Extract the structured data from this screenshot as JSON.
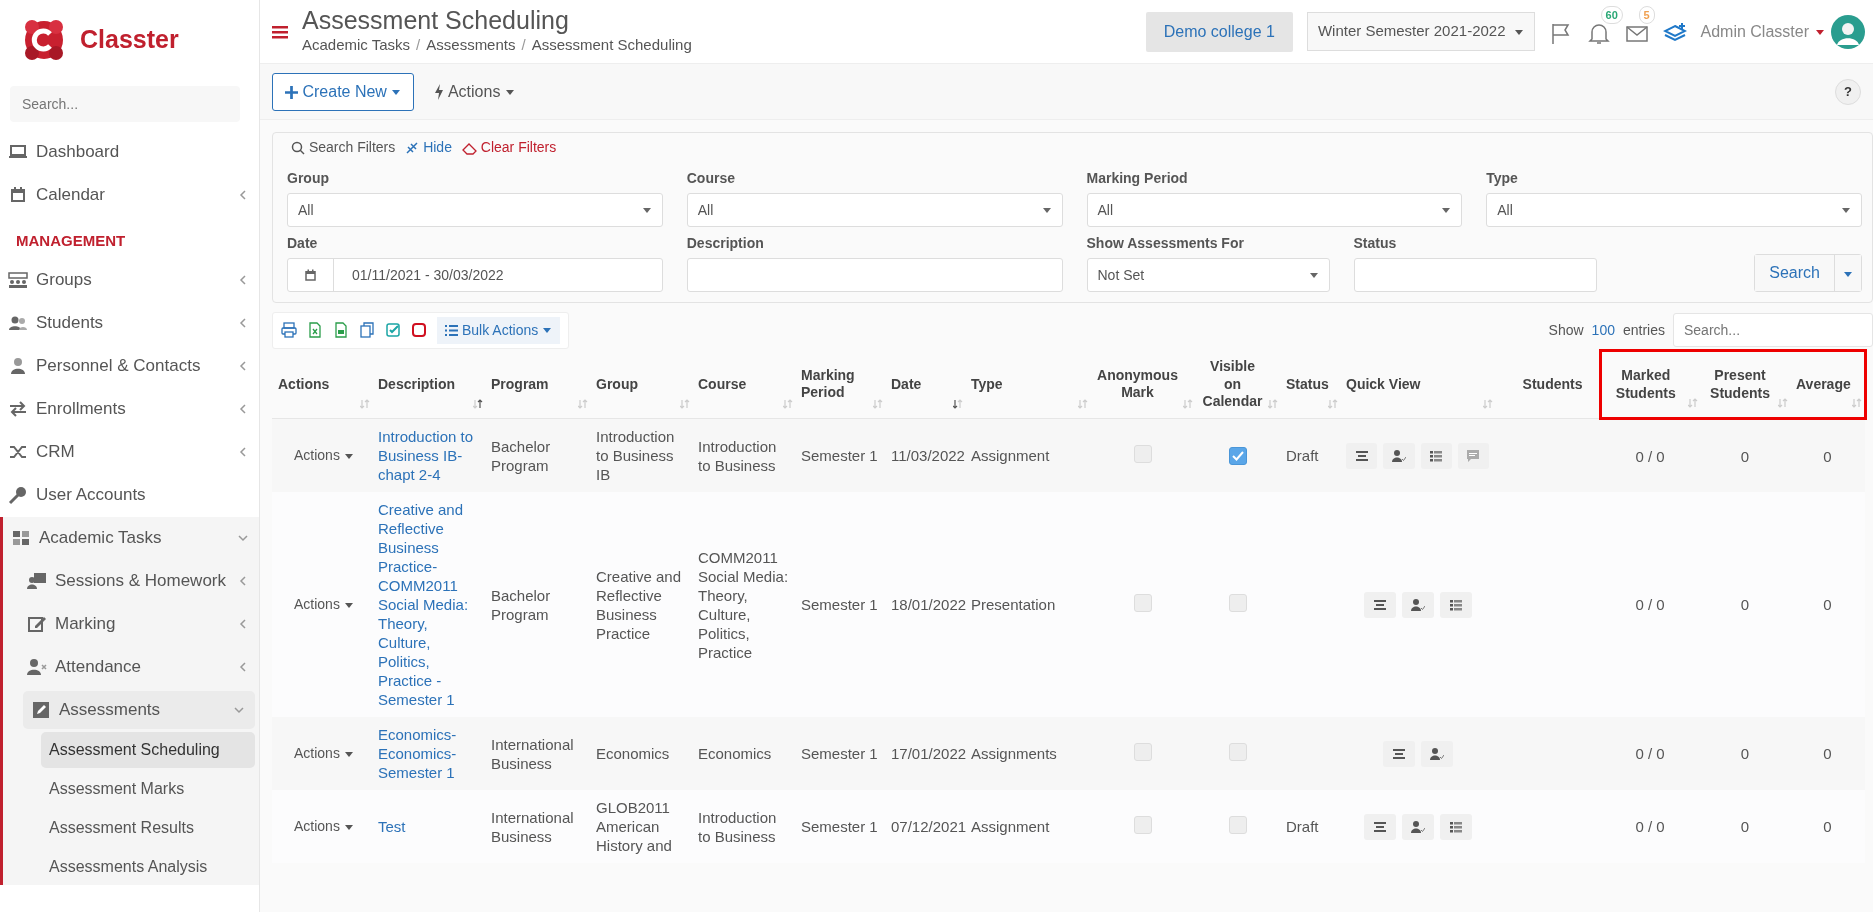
{
  "sidebar": {
    "brand": "Classter",
    "search_placeholder": "Search...",
    "items": [
      {
        "kind": "link",
        "label": "Dashboard"
      },
      {
        "kind": "link",
        "label": "Calendar",
        "expanded": false
      },
      {
        "kind": "section",
        "label": "MANAGEMENT"
      },
      {
        "kind": "link",
        "label": "Groups",
        "expanded": false
      },
      {
        "kind": "link",
        "label": "Students",
        "expanded": false
      },
      {
        "kind": "link",
        "label": "Personnel & Contacts",
        "expanded": false
      },
      {
        "kind": "link",
        "label": "Enrollments",
        "expanded": false
      },
      {
        "kind": "link",
        "label": "CRM",
        "expanded": false
      },
      {
        "kind": "link",
        "label": "User Accounts"
      },
      {
        "kind": "link",
        "label": "Academic Tasks",
        "expanded": true,
        "children": [
          {
            "label": "Sessions & Homework",
            "expanded": false
          },
          {
            "label": "Marking",
            "expanded": false
          },
          {
            "label": "Attendance",
            "expanded": false
          },
          {
            "label": "Assessments",
            "expanded": true,
            "children": [
              {
                "label": "Assessment Scheduling",
                "selected": true
              },
              {
                "label": "Assessment Marks",
                "selected": false
              },
              {
                "label": "Assessment Results",
                "selected": false
              },
              {
                "label": "Assessments Analysis",
                "selected": false
              }
            ]
          }
        ]
      }
    ]
  },
  "header": {
    "title": "Assessment Scheduling",
    "breadcrumb": [
      {
        "label": "Academic Tasks",
        "separator": "/"
      },
      {
        "label": "Assessments",
        "separator": "/"
      },
      {
        "label": "Assessment Scheduling"
      }
    ],
    "institution": "Demo college 1",
    "period": "Winter Semester 2021-2022",
    "indicators": [
      {
        "kind": "flag"
      },
      {
        "kind": "bell",
        "count": "60",
        "color": "#2aa876"
      },
      {
        "kind": "mail",
        "count": "5",
        "color": "#f0a050"
      },
      {
        "kind": "layers"
      }
    ],
    "user": "Admin Classter"
  },
  "toolbar": {
    "create": "Create New",
    "actions": "Actions",
    "help": "?"
  },
  "filters": {
    "title": "Search Filters",
    "hide": "Hide",
    "clear": "Clear Filters",
    "fields": [
      {
        "kind": "select",
        "label": "Group",
        "value": "All"
      },
      {
        "kind": "select",
        "label": "Course",
        "value": "All"
      },
      {
        "kind": "select",
        "label": "Marking Period",
        "value": "All"
      },
      {
        "kind": "select",
        "label": "Type",
        "value": "All"
      },
      {
        "kind": "daterange",
        "label": "Date",
        "value": "01/11/2021 - 30/03/2022"
      },
      {
        "kind": "text",
        "label": "Description"
      },
      {
        "kind": "select",
        "label": "Show Assessments For",
        "value": "Not Set"
      },
      {
        "kind": "text",
        "label": "Status"
      }
    ],
    "search_button": "Search"
  },
  "table_tools": {
    "exports": [
      {
        "kind": "print"
      },
      {
        "kind": "excel"
      },
      {
        "kind": "csv"
      },
      {
        "kind": "copy"
      },
      {
        "kind": "check"
      },
      {
        "kind": "stop"
      }
    ],
    "bulk": "Bulk Actions",
    "show": "Show",
    "length": "100",
    "entries": "entries",
    "search_placeholder": "Search..."
  },
  "table": {
    "columns": [
      {
        "label": "Actions",
        "sorted": false,
        "highlighted": false
      },
      {
        "label": "Description",
        "sorted": true,
        "descending": false,
        "highlighted": false
      },
      {
        "label": "Program",
        "sorted": false,
        "highlighted": false
      },
      {
        "label": "Group",
        "sorted": false,
        "highlighted": false
      },
      {
        "label": "Course",
        "sorted": false,
        "highlighted": false
      },
      {
        "label": "Marking Period",
        "sorted": false,
        "highlighted": false
      },
      {
        "label": "Date",
        "sorted": true,
        "descending": true,
        "highlighted": false
      },
      {
        "label": "Type",
        "sorted": false,
        "highlighted": false
      },
      {
        "label": "Anonymous Mark",
        "sorted": false,
        "highlighted": false
      },
      {
        "label": "Visible on Calendar",
        "sorted": false,
        "highlighted": false
      },
      {
        "label": "Status",
        "sorted": false,
        "highlighted": false
      },
      {
        "label": "Quick View",
        "sorted": false,
        "highlighted": false
      },
      {
        "label": "Students",
        "highlighted": false
      },
      {
        "label": "Marked Students",
        "sorted": false,
        "highlighted": true
      },
      {
        "label": "Present Students",
        "sorted": false,
        "highlighted": true
      },
      {
        "label": "Average",
        "sorted": false,
        "highlighted": true
      }
    ],
    "rows": [
      {
        "actions": "Actions",
        "description": "Introduction to Business IB-chapt 2-4",
        "program": "Bachelor Program",
        "group": "Introduction to Business IB",
        "course": "Introduction to Business",
        "period": "Semester 1",
        "date": "11/03/2022",
        "type": "Assignment",
        "anonymous": false,
        "visible": true,
        "status": "Draft",
        "quick_view": [
          {
            "kind": "summary"
          },
          {
            "kind": "attendance"
          },
          {
            "kind": "list"
          },
          {
            "kind": "comment"
          }
        ],
        "marked": "0 / 0",
        "present": "0",
        "average": "0"
      },
      {
        "actions": "Actions",
        "description": "Creative and Reflective Business Practice-COMM2011 Social Media: Theory, Culture, Politics, Practice - Semester 1",
        "program": "Bachelor Program",
        "group": "Creative and Reflective Business Practice",
        "course": "COMM2011 Social Media: Theory, Culture, Politics, Practice",
        "period": "Semester 1",
        "date": "18/01/2022",
        "type": "Presentation",
        "anonymous": false,
        "visible": false,
        "quick_view": [
          {
            "kind": "summary"
          },
          {
            "kind": "attendance"
          },
          {
            "kind": "list"
          }
        ],
        "marked": "0 / 0",
        "present": "0",
        "average": "0"
      },
      {
        "actions": "Actions",
        "description": "Economics-Economics-Semester 1",
        "program": "International Business",
        "group": "Economics",
        "course": "Economics",
        "period": "Semester 1",
        "date": "17/01/2022",
        "type": "Assignments",
        "anonymous": false,
        "visible": false,
        "quick_view": [
          {
            "kind": "summary"
          },
          {
            "kind": "attendance"
          }
        ],
        "marked": "0 / 0",
        "present": "0",
        "average": "0"
      },
      {
        "actions": "Actions",
        "description": "Test",
        "program": "International Business",
        "group": "GLOB2011 American History and",
        "course": "Introduction to Business",
        "period": "Semester 1",
        "date": "07/12/2021",
        "type": "Assignment",
        "anonymous": false,
        "visible": false,
        "status": "Draft",
        "quick_view": [
          {
            "kind": "summary"
          },
          {
            "kind": "attendance"
          },
          {
            "kind": "list"
          }
        ],
        "marked": "0 / 0",
        "present": "0",
        "average": "0"
      }
    ]
  }
}
